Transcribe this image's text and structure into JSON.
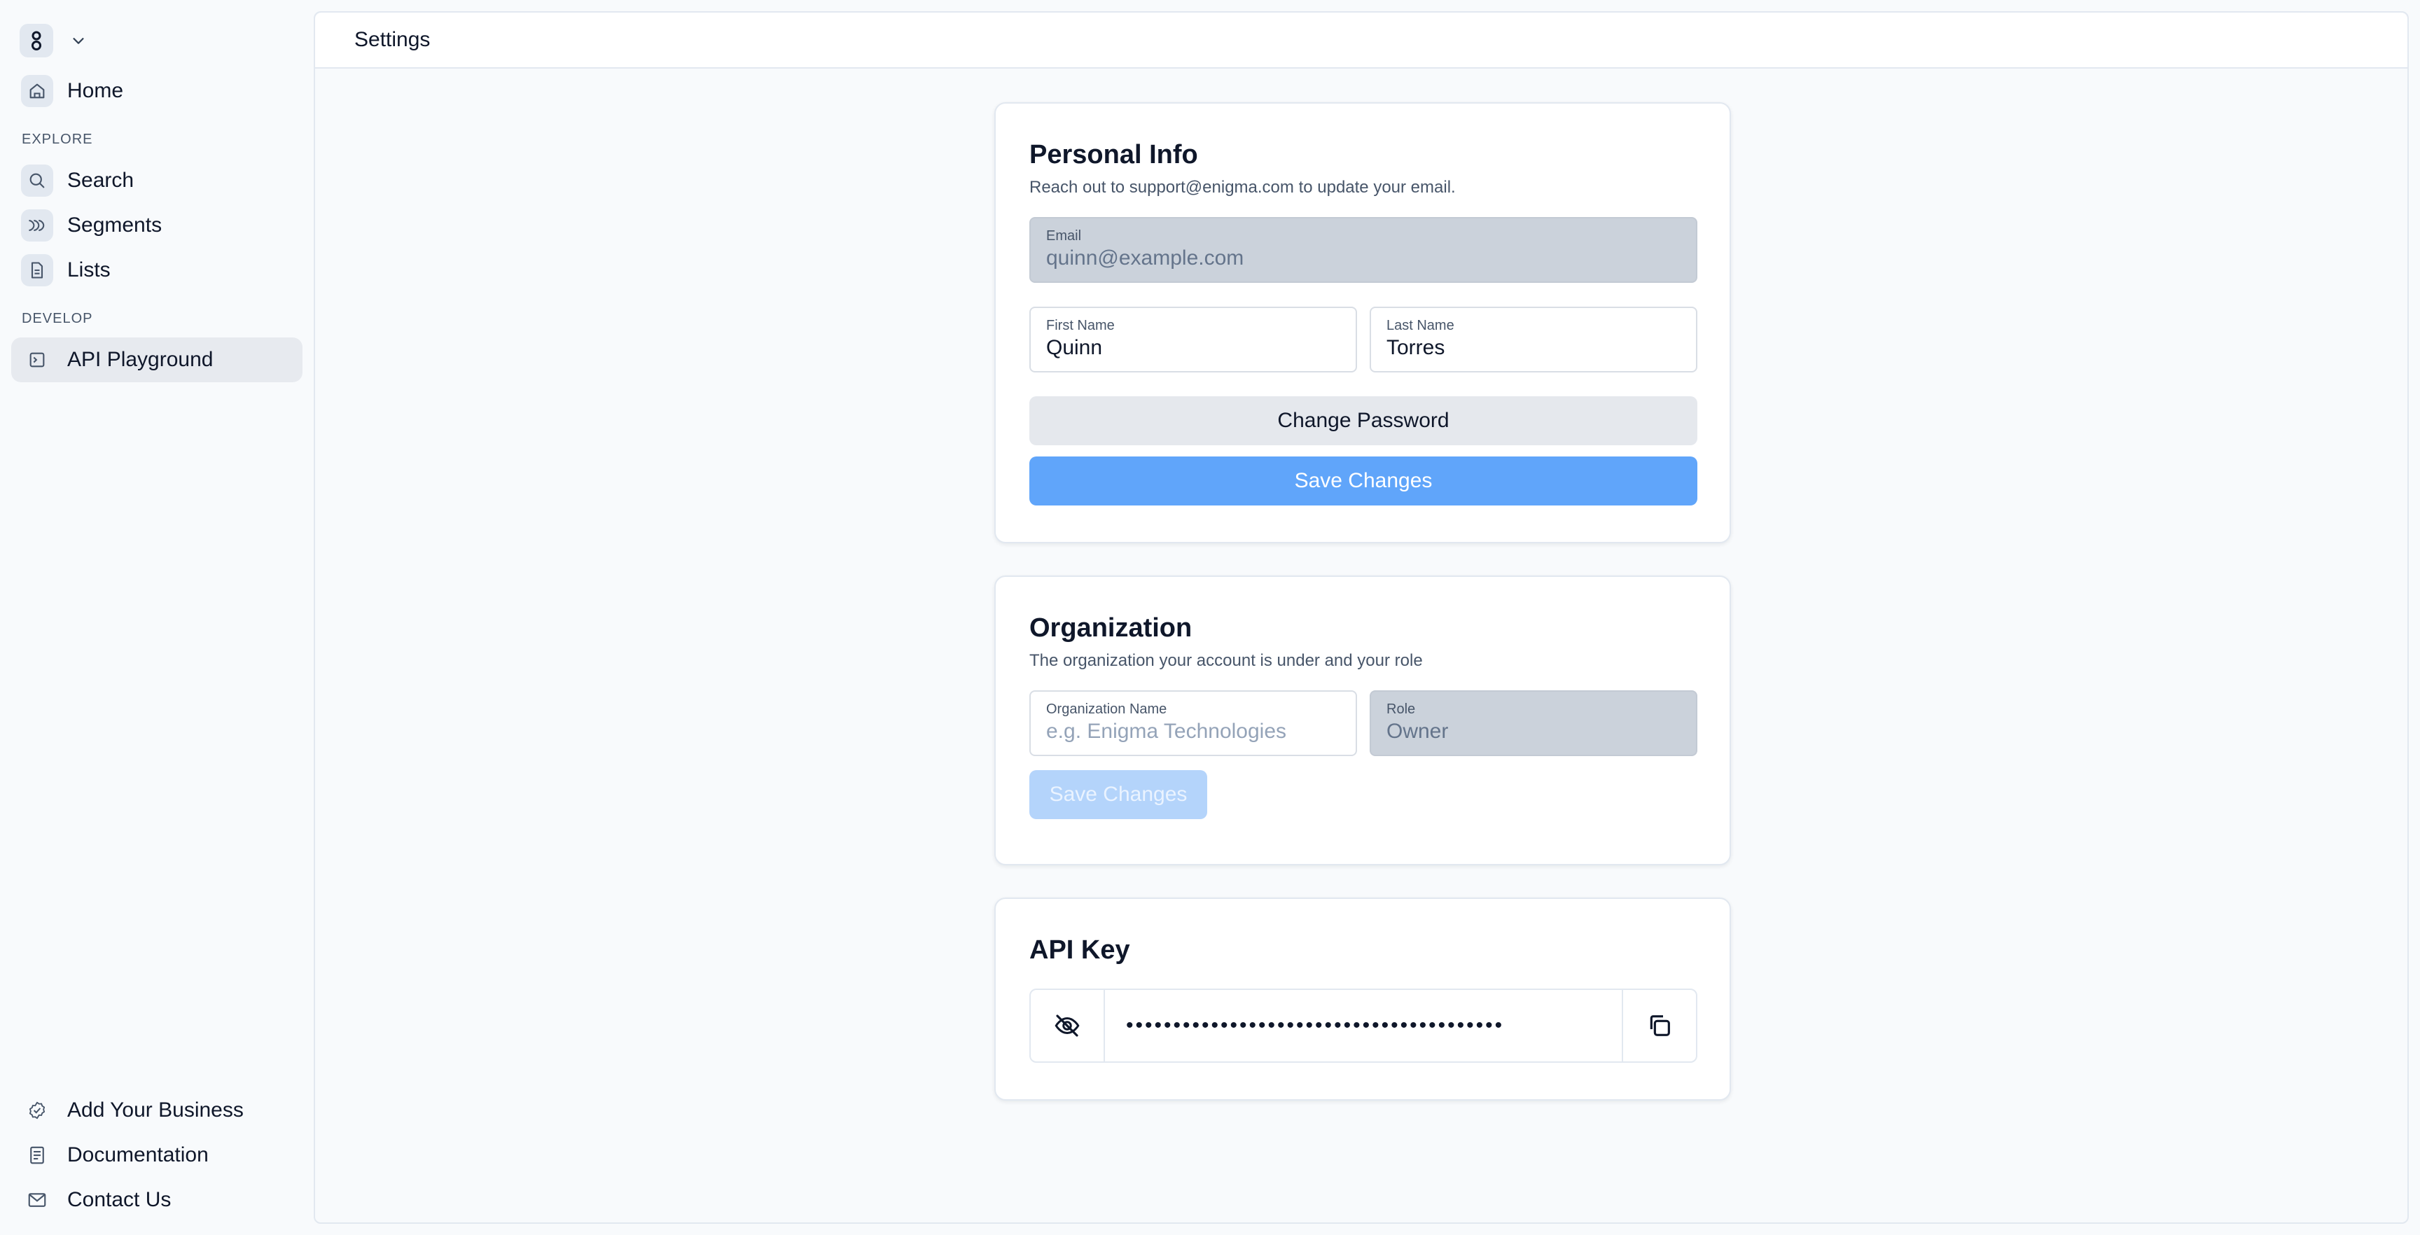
{
  "sidebar": {
    "home": {
      "label": "Home",
      "icon": "home-icon"
    },
    "sections": {
      "explore": "EXPLORE",
      "develop": "DEVELOP"
    },
    "explore_items": [
      {
        "label": "Search",
        "icon": "search-icon"
      },
      {
        "label": "Segments",
        "icon": "segments-icon"
      },
      {
        "label": "Lists",
        "icon": "document-icon"
      }
    ],
    "develop_items": [
      {
        "label": "API Playground",
        "icon": "terminal-icon",
        "active": true
      }
    ],
    "bottom_items": [
      {
        "label": "Add Your Business",
        "icon": "badge-check-icon"
      },
      {
        "label": "Documentation",
        "icon": "book-icon"
      },
      {
        "label": "Contact Us",
        "icon": "mail-icon"
      }
    ]
  },
  "header": {
    "title": "Settings"
  },
  "personal_info": {
    "title": "Personal Info",
    "subtitle": "Reach out to support@enigma.com to update your email.",
    "email": {
      "label": "Email",
      "value": "quinn@example.com",
      "disabled": true
    },
    "first_name": {
      "label": "First Name",
      "value": "Quinn"
    },
    "last_name": {
      "label": "Last Name",
      "value": "Torres"
    },
    "change_password_label": "Change Password",
    "save_label": "Save Changes"
  },
  "organization": {
    "title": "Organization",
    "subtitle": "The organization your account is under and your role",
    "org_name": {
      "label": "Organization Name",
      "value": "",
      "placeholder": "e.g. Enigma Technologies"
    },
    "role": {
      "label": "Role",
      "value": "Owner",
      "disabled": true
    },
    "save_label": "Save Changes",
    "save_disabled": true
  },
  "api_key": {
    "title": "API Key",
    "masked_value": "••••••••••••••••••••••••••••••••••••••••",
    "toggle_icon": "eye-off-icon",
    "copy_icon": "copy-icon"
  },
  "colors": {
    "accent": "#60a5fa",
    "accent_disabled": "#b4d4fb",
    "background": "#f8fafc",
    "disabled_field": "#cbd2db"
  }
}
